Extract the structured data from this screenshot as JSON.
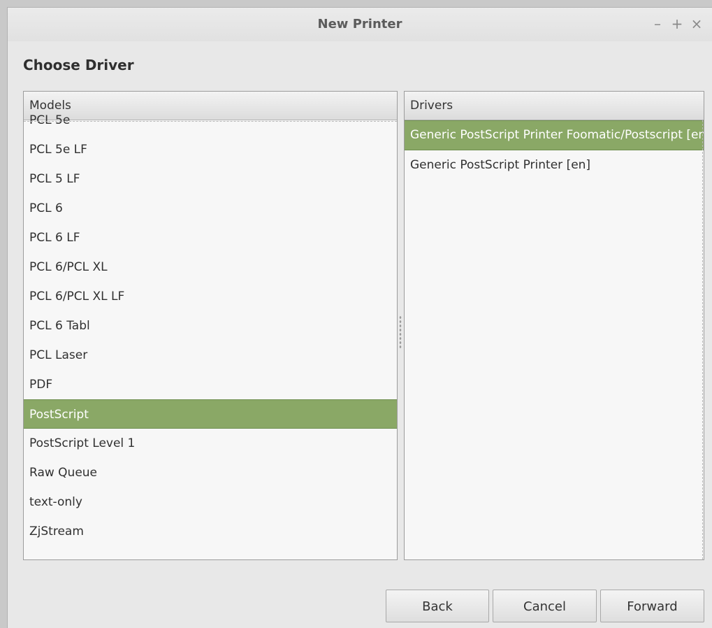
{
  "window": {
    "title": "New Printer",
    "controls": {
      "minimize": "–",
      "maximize": "+",
      "close": "×"
    }
  },
  "page": {
    "heading": "Choose Driver"
  },
  "models": {
    "header": "Models",
    "items": [
      "PCL 5e",
      "PCL 5e LF",
      "PCL 5 LF",
      "PCL 6",
      "PCL 6 LF",
      "PCL 6/PCL XL",
      "PCL 6/PCL XL LF",
      "PCL 6 Tabl",
      "PCL Laser",
      "PDF",
      "PostScript",
      "PostScript Level 1",
      "Raw Queue",
      "text-only",
      "ZjStream"
    ],
    "selected": "PostScript"
  },
  "drivers": {
    "header": "Drivers",
    "items": [
      "Generic PostScript Printer Foomatic/Postscript [en] (recommended)",
      "Generic PostScript Printer [en]"
    ],
    "selected": "Generic PostScript Printer Foomatic/Postscript [en] (recommended)"
  },
  "buttons": {
    "back": "Back",
    "cancel": "Cancel",
    "forward": "Forward"
  },
  "colors": {
    "selection": "#8aa866",
    "background": "#e8e8e8"
  }
}
